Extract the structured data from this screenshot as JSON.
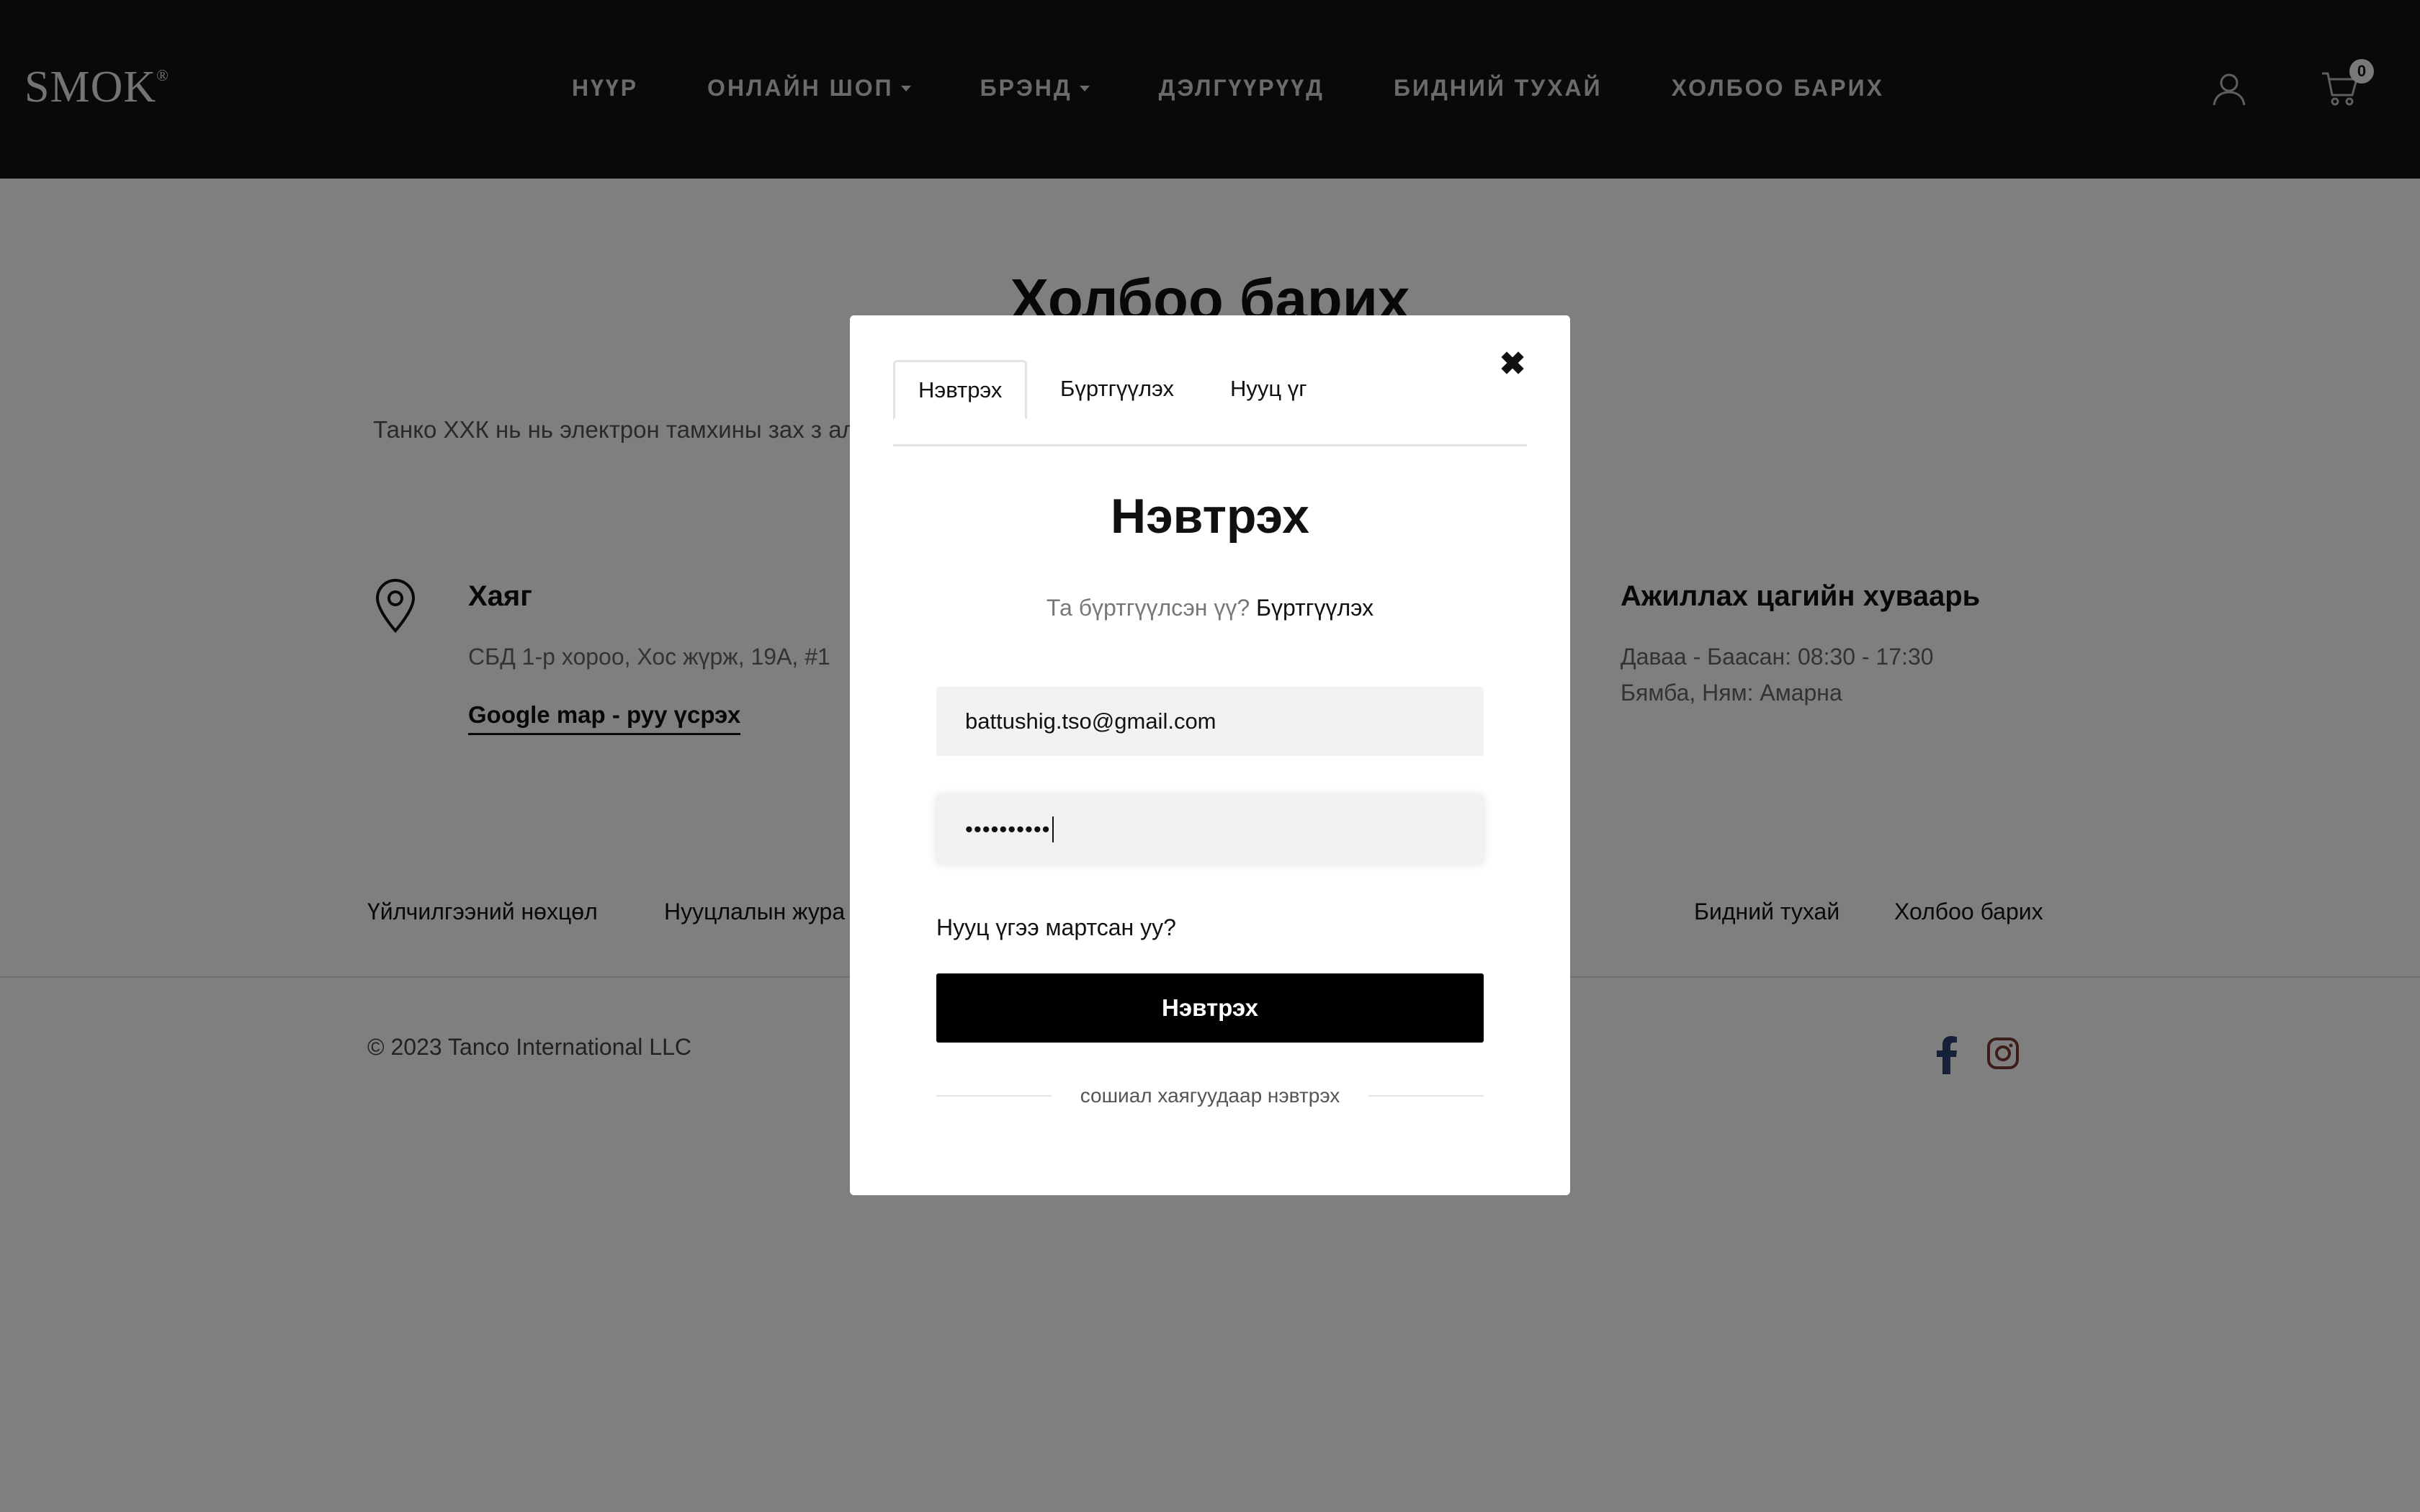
{
  "brand": {
    "name": "SMOK",
    "mark": "®"
  },
  "nav": {
    "items": [
      {
        "label": "НҮҮР",
        "dropdown": false
      },
      {
        "label": "ОНЛАЙН ШОП",
        "dropdown": true
      },
      {
        "label": "БРЭНД",
        "dropdown": true
      },
      {
        "label": "ДЭЛГҮҮРҮҮД",
        "dropdown": false
      },
      {
        "label": "БИДНИЙ ТУХАЙ",
        "dropdown": false
      },
      {
        "label": "ХОЛБОО БАРИХ",
        "dropdown": false
      }
    ],
    "cart_count": "0",
    "icons": {
      "user": "user-icon",
      "cart": "cart-icon"
    }
  },
  "page": {
    "title": "Холбоо барих",
    "intro": "Танко ХХК нь нь электрон тамхины зах з                                                                                                   албан ёсны дистрибьютер компани юм.",
    "address": {
      "title": "Хаяг",
      "line": "СБД 1-р хороо, Хос жүрж, 19А, #1",
      "map_link": "Google map - руу үсрэх"
    },
    "hours": {
      "title": "Ажиллах цагийн хуваарь",
      "weekdays": "Даваа - Баасан: 08:30 - 17:30",
      "weekend": "Бямба, Ням: Амарна"
    }
  },
  "footer": {
    "links": {
      "terms": "Үйлчилгээний нөхцөл",
      "privacy": "Нууцлалын жура",
      "about": "Бидний тухай",
      "contact": "Холбоо барих"
    },
    "copyright": "© 2023 Tanco International LLC",
    "social": {
      "facebook": "facebook-icon",
      "instagram": "instagram-icon"
    },
    "colors": {
      "facebook": "#2d4373",
      "instagram": "#7a3a33"
    }
  },
  "modal": {
    "close_label": "✖",
    "tabs": [
      {
        "label": "Нэвтрэх",
        "active": true
      },
      {
        "label": "Бүртгүүлэх",
        "active": false
      },
      {
        "label": "Нууц үг",
        "active": false
      }
    ],
    "title": "Нэвтрэх",
    "registered_question": "Та бүртгүүлсэн үү?",
    "register_link": "Бүртгүүлэх",
    "email_value": "battushig.tso@gmail.com",
    "password_value": "••••••••••",
    "forgot_label": "Нууц үгээ мартсан уу?",
    "submit_label": "Нэвтрэх",
    "social_label": "сошиал хаягуудаар нэвтрэх"
  },
  "colors": {
    "header_bg": "#101217",
    "overlay": "rgba(0,0,0,0.5)",
    "button_bg": "#000000",
    "input_bg": "#f2f2f2"
  }
}
